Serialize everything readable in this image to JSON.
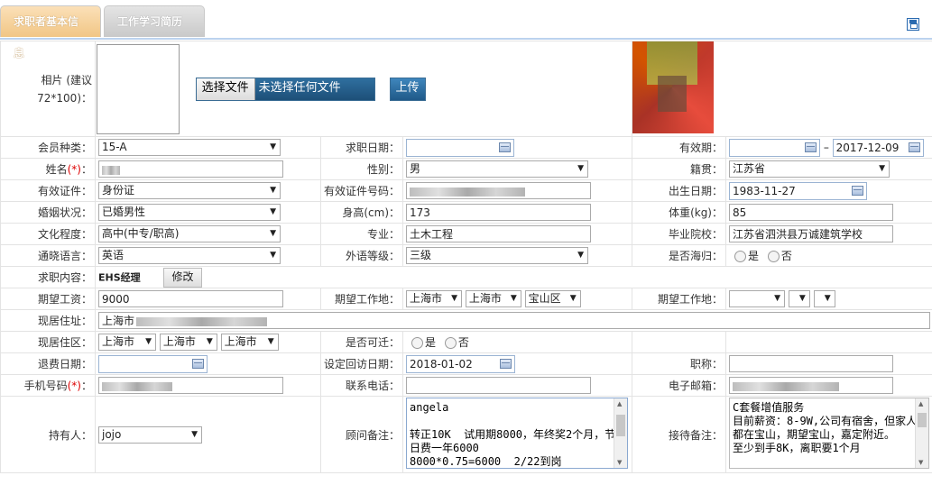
{
  "tabs": [
    {
      "label": "求职者基本信息"
    },
    {
      "label": "工作学习简历"
    }
  ],
  "photo": {
    "label": "相片 (建议72*100)：",
    "choose_file": "选择文件",
    "no_file": "未选择任何文件",
    "upload": "上传"
  },
  "rows": {
    "member_type": {
      "label": "会员种类：",
      "value": "15-A"
    },
    "job_date": {
      "label": "求职日期：",
      "value": ""
    },
    "valid_period": {
      "label": "有效期：",
      "from": "",
      "sep": "–",
      "to": "2017-12-09"
    },
    "name": {
      "label": "姓名",
      "req": "(*)",
      "colon": "："
    },
    "gender": {
      "label": "性别：",
      "value": "男"
    },
    "native": {
      "label": "籍贯：",
      "value": "江苏省"
    },
    "id_type": {
      "label": "有效证件：",
      "value": "身份证"
    },
    "id_no": {
      "label": "有效证件号码："
    },
    "birth": {
      "label": "出生日期：",
      "value": "1983-11-27"
    },
    "marital": {
      "label": "婚姻状况：",
      "value": "已婚男性"
    },
    "height": {
      "label": "身高(cm)：",
      "value": "173"
    },
    "weight": {
      "label": "体重(kg)：",
      "value": "85"
    },
    "education": {
      "label": "文化程度：",
      "value": "高中(中专/职高)"
    },
    "major": {
      "label": "专业：",
      "value": "土木工程"
    },
    "school": {
      "label": "毕业院校：",
      "value": "江苏省泗洪县万诚建筑学校"
    },
    "language": {
      "label": "通晓语言：",
      "value": "英语"
    },
    "lang_level": {
      "label": "外语等级：",
      "value": "三级"
    },
    "returnee": {
      "label": "是否海归：",
      "yes": "是",
      "no": "否"
    },
    "job_content": {
      "label": "求职内容：",
      "value": "EHS经理",
      "edit": "修改"
    },
    "salary": {
      "label": "期望工资：",
      "value": "9000"
    },
    "work_place": {
      "label": "期望工作地：",
      "a": "上海市",
      "b": "上海市",
      "c": "宝山区"
    },
    "work_place2": {
      "label": "期望工作地："
    },
    "address": {
      "label": "现居住址：",
      "value": "上海市"
    },
    "district": {
      "label": "现居住区：",
      "a": "上海市",
      "b": "上海市",
      "c": "上海市"
    },
    "relocate": {
      "label": "是否可迁：",
      "yes": "是",
      "no": "否"
    },
    "refund_date": {
      "label": "退费日期：",
      "value": ""
    },
    "visit_date": {
      "label": "设定回访日期：",
      "value": "2018-01-02"
    },
    "title": {
      "label": "职称：",
      "value": ""
    },
    "phone": {
      "label": "手机号码",
      "req": "(*)",
      "colon": "："
    },
    "tel": {
      "label": "联系电话：",
      "value": ""
    },
    "email": {
      "label": "电子邮箱："
    },
    "holder": {
      "label": "持有人：",
      "value": "jojo"
    },
    "consultant_note": {
      "label": "顾问备注：",
      "value": "angela\n\n转正10K  试用期8000，年终奖2个月，节日费一年6000\n8000*0.75=6000  2/22到岗"
    },
    "reception_note": {
      "label": "接待备注：",
      "value": "C套餐增值服务\n目前薪资：8-9W,公司有宿舍，但家人都在宝山，期望宝山，嘉定附近。\n至少到手8K，离职要1个月"
    }
  }
}
